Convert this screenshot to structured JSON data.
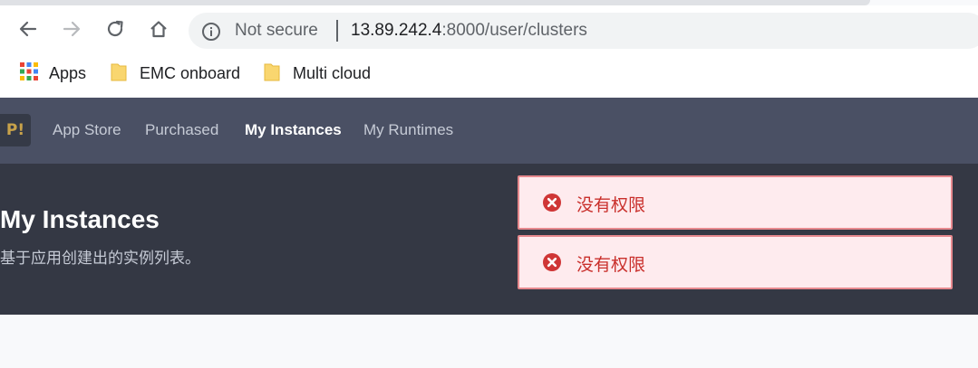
{
  "browser": {
    "security_label": "Not secure",
    "url_host": "13.89.242.4",
    "url_rest": ":8000/user/clusters",
    "nav_icons": [
      "back-arrow-icon",
      "forward-arrow-icon",
      "reload-icon",
      "home-icon"
    ]
  },
  "bookmarks": [
    {
      "label": "Apps",
      "icon": "apps-grid-icon"
    },
    {
      "label": "EMC onboard",
      "icon": "folder-icon"
    },
    {
      "label": "Multi cloud",
      "icon": "folder-icon"
    }
  ],
  "app": {
    "logo_text": "P!",
    "nav": [
      {
        "label": "App Store",
        "active": false
      },
      {
        "label": "Purchased",
        "active": false
      },
      {
        "label": "My Instances",
        "active": true
      },
      {
        "label": "My Runtimes",
        "active": false
      }
    ],
    "page_title": "My Instances",
    "page_subtitle": "基于应用创建出的实例列表。"
  },
  "notifications": [
    {
      "message": "没有权限",
      "type": "error"
    },
    {
      "message": "没有权限",
      "type": "error"
    }
  ],
  "colors": {
    "nav_bg": "#4a5064",
    "hero_bg": "#343844",
    "error_bg": "#feebee",
    "error_border": "#e7898e",
    "error_text": "#c9302c"
  }
}
